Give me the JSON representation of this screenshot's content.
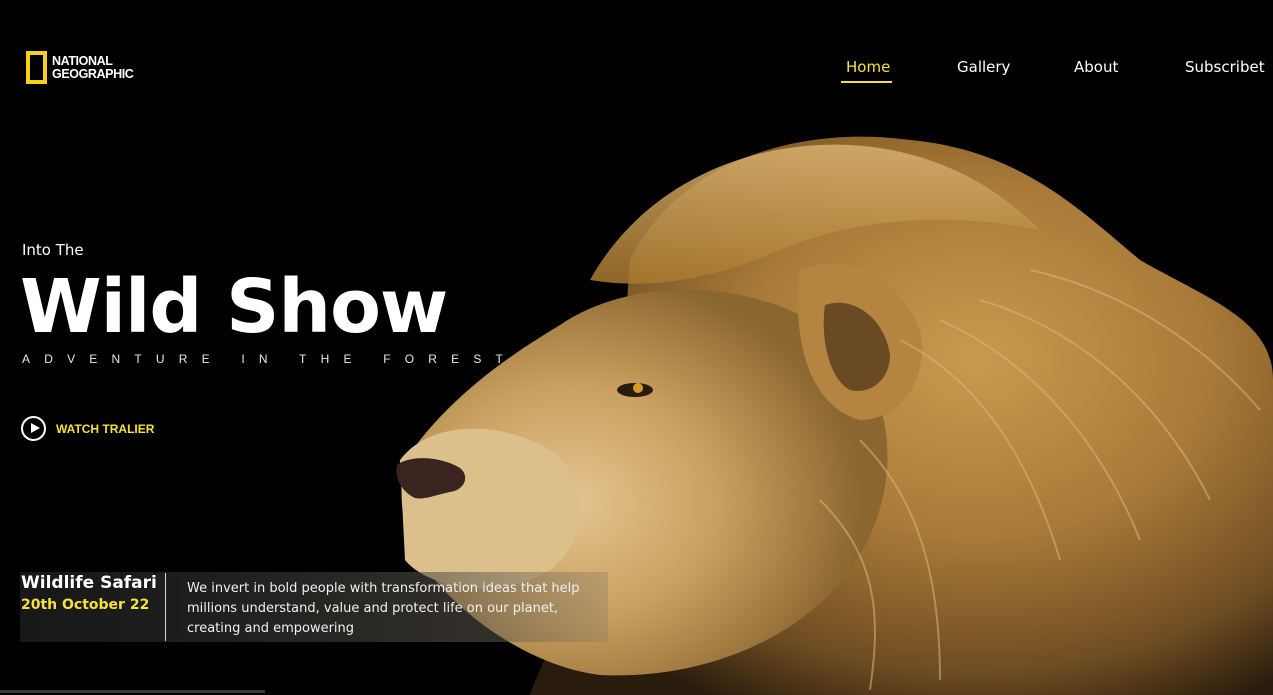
{
  "brand": {
    "line1": "NATIONAL",
    "line2": "GEOGRAPHIC",
    "accent": "#f5cf1a"
  },
  "nav": {
    "items": [
      {
        "label": "Home",
        "active": true
      },
      {
        "label": "Gallery",
        "active": false
      },
      {
        "label": "About",
        "active": false
      },
      {
        "label": "Subscribet",
        "active": false
      }
    ],
    "active_color": "#f5e13a"
  },
  "hero": {
    "kicker": "Into The",
    "title": "Wild Show",
    "tagline": "ADVENTURE IN THE FOREST",
    "cta_label": "WATCH TRALIER",
    "cta_icon": "play-circle-icon"
  },
  "event": {
    "title": "Wildlife Safari",
    "date": "20th October 22",
    "description": "We invert in bold people with transformation ideas that help millions understand, value and protect life on our planet, creating and empowering"
  },
  "hero_image": {
    "subject": "lion-portrait"
  }
}
